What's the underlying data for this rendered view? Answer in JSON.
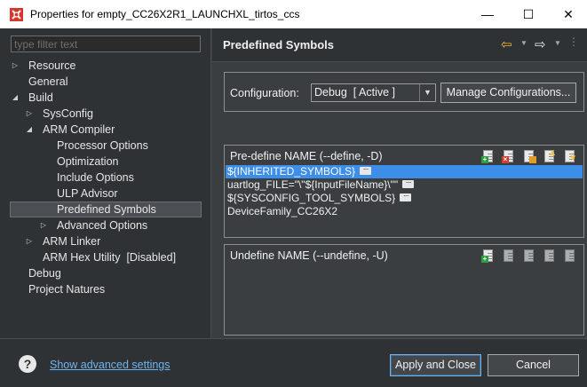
{
  "window": {
    "title": "Properties for empty_CC26X2R1_LAUNCHXL_tirtos_ccs",
    "minimize_glyph": "—",
    "maximize_glyph": "☐",
    "close_glyph": "✕"
  },
  "filter": {
    "placeholder": "type filter text"
  },
  "tree": [
    {
      "label": "Resource",
      "arrow": "▷"
    },
    {
      "label": "General",
      "arrow": ""
    },
    {
      "label": "Build",
      "arrow": "◢"
    },
    {
      "label": "SysConfig",
      "arrow": "▷"
    },
    {
      "label": "ARM Compiler",
      "arrow": "◢"
    },
    {
      "label": "Processor Options",
      "arrow": ""
    },
    {
      "label": "Optimization",
      "arrow": ""
    },
    {
      "label": "Include Options",
      "arrow": ""
    },
    {
      "label": "ULP Advisor",
      "arrow": ""
    },
    {
      "label": "Predefined Symbols",
      "arrow": "",
      "selected": true
    },
    {
      "label": "Advanced Options",
      "arrow": "▷"
    },
    {
      "label": "ARM Linker",
      "arrow": "▷"
    },
    {
      "label": "ARM Hex Utility  [Disabled]",
      "arrow": ""
    },
    {
      "label": "Debug",
      "arrow": ""
    },
    {
      "label": "Project Natures",
      "arrow": ""
    }
  ],
  "page": {
    "title": "Predefined Symbols",
    "icons": [
      "back-arrow-icon",
      "forward-arrow-icon",
      "view-menu-icon"
    ]
  },
  "configuration": {
    "label": "Configuration:",
    "selected": "Debug  [ Active ]",
    "manage_label": "Manage Configurations..."
  },
  "predefine": {
    "title": "Pre-define NAME (--define, -D)",
    "symbols": [
      "${INHERITED_SYMBOLS}",
      "uartlog_FILE=\"\\\"${InputFileName}\\\"\"",
      "${SYSCONFIG_TOOL_SYMBOLS}",
      "DeviceFamily_CC26X2"
    ],
    "more_glyph": "···"
  },
  "undefine": {
    "title": "Undefine NAME (--undefine, -U)"
  },
  "footer": {
    "help_glyph": "?",
    "advanced_link": "Show advanced settings",
    "apply_label": "Apply and Close",
    "cancel_label": "Cancel"
  },
  "colors": {
    "selection": "#3d8ee8",
    "link": "#6fb3f2",
    "accent_back": "#f0b93a"
  }
}
